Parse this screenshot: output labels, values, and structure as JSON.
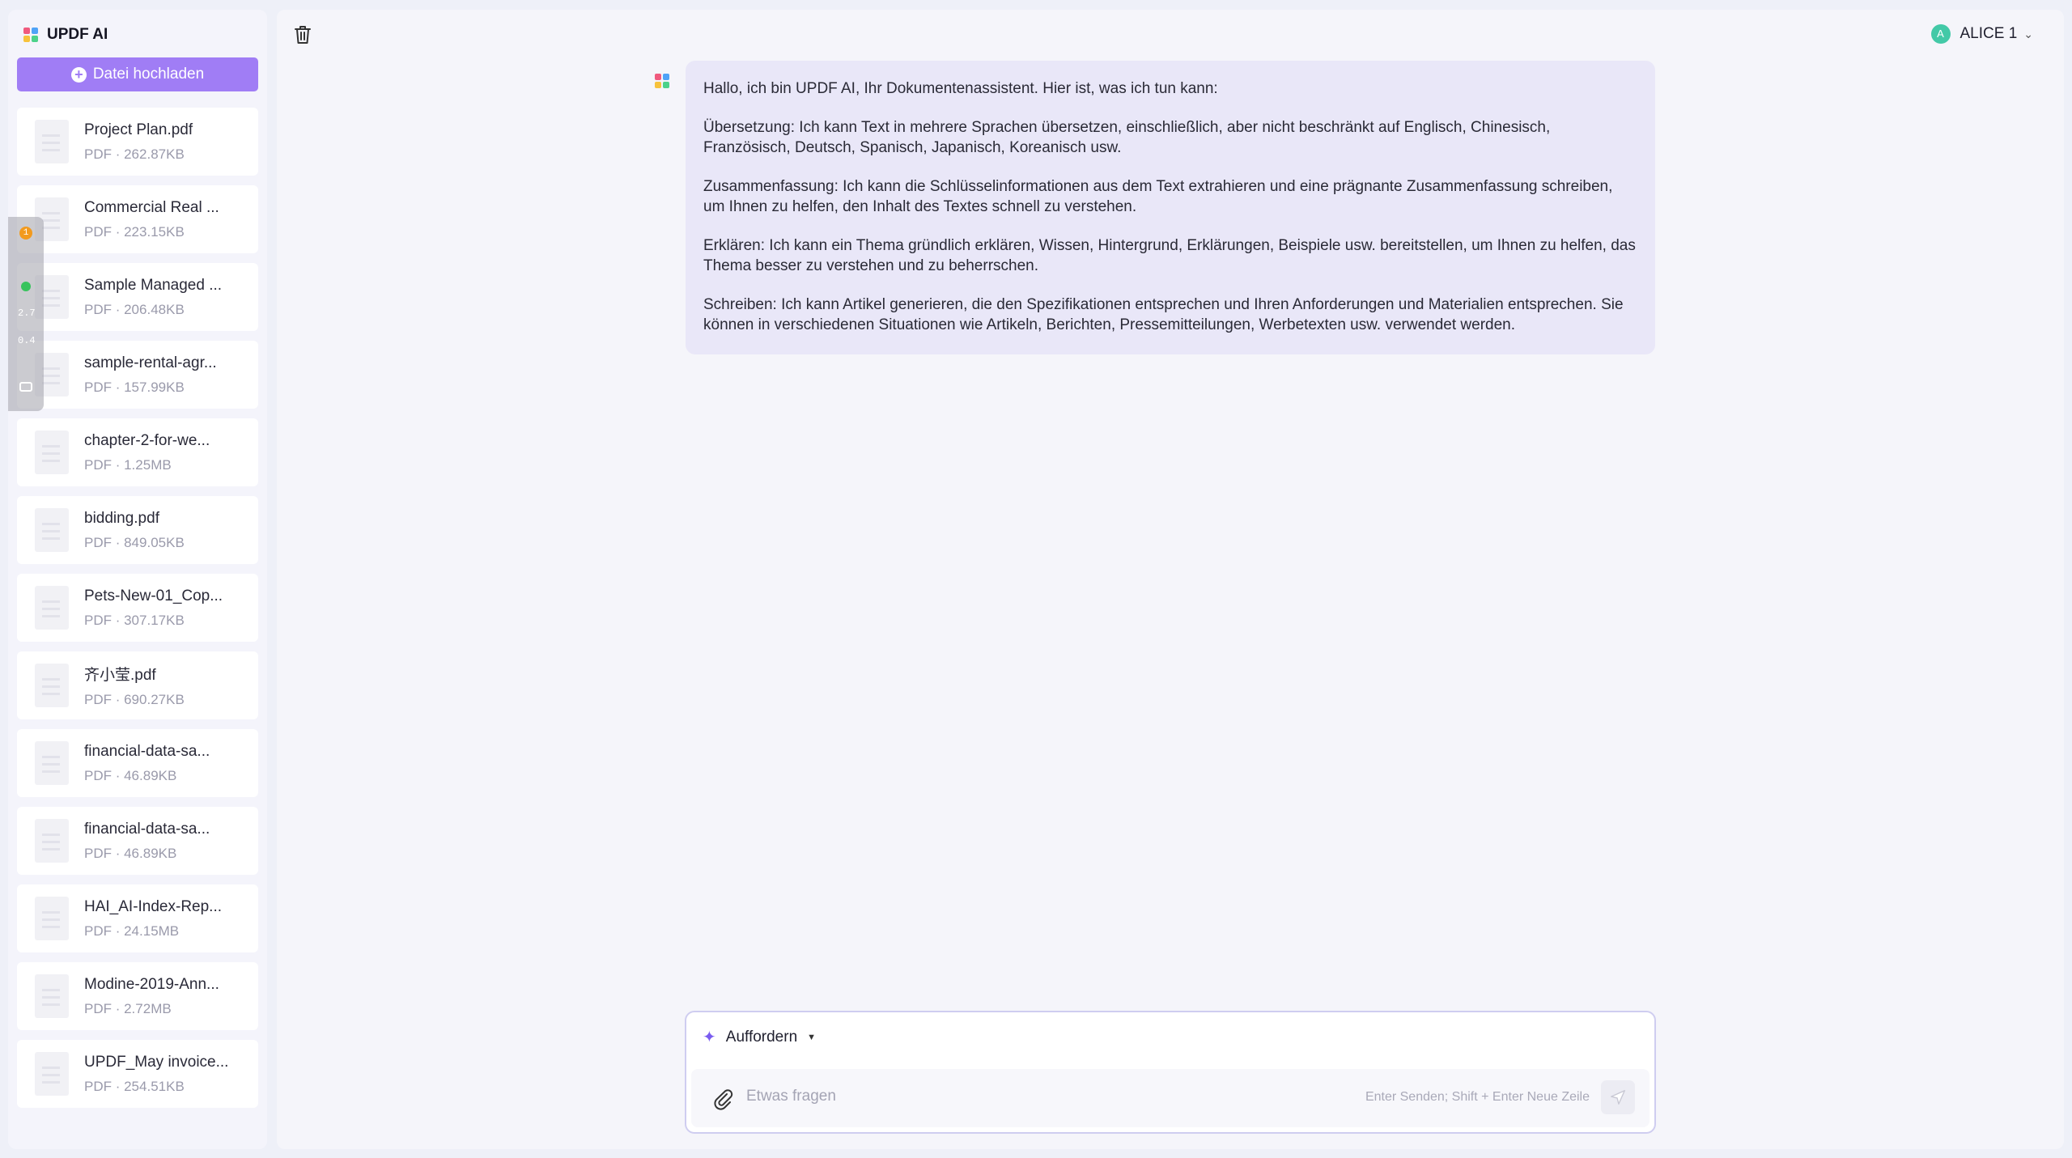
{
  "app": {
    "title": "UPDF AI"
  },
  "sidebar": {
    "upload_label": "Datei hochladen",
    "files": [
      {
        "name": "Project Plan.pdf",
        "meta": "PDF · 262.87KB"
      },
      {
        "name": "Commercial Real ...",
        "meta": "PDF · 223.15KB"
      },
      {
        "name": "Sample Managed ...",
        "meta": "PDF · 206.48KB"
      },
      {
        "name": "sample-rental-agr...",
        "meta": "PDF · 157.99KB"
      },
      {
        "name": "chapter-2-for-we...",
        "meta": "PDF · 1.25MB"
      },
      {
        "name": "bidding.pdf",
        "meta": "PDF · 849.05KB"
      },
      {
        "name": "Pets-New-01_Cop...",
        "meta": "PDF · 307.17KB"
      },
      {
        "name": "齐小莹.pdf",
        "meta": "PDF · 690.27KB"
      },
      {
        "name": "financial-data-sa...",
        "meta": "PDF · 46.89KB"
      },
      {
        "name": "financial-data-sa...",
        "meta": "PDF · 46.89KB"
      },
      {
        "name": "HAI_AI-Index-Rep...",
        "meta": "PDF · 24.15MB"
      },
      {
        "name": "Modine-2019-Ann...",
        "meta": "PDF · 2.72MB"
      },
      {
        "name": "UPDF_May invoice...",
        "meta": "PDF · 254.51KB"
      }
    ]
  },
  "overlay": {
    "badge": "1",
    "upload_speed": "2.7",
    "download_speed": "0.4"
  },
  "header": {
    "user_name": "ALICE 1",
    "avatar_letter": "A"
  },
  "chat": {
    "messages": [
      "Hallo, ich bin UPDF AI, Ihr Dokumentenassistent. Hier ist, was ich tun kann:",
      "Übersetzung: Ich kann Text in mehrere Sprachen übersetzen, einschließlich, aber nicht beschränkt auf Englisch, Chinesisch, Französisch, Deutsch, Spanisch, Japanisch, Koreanisch usw.",
      "Zusammenfassung: Ich kann die Schlüsselinformationen aus dem Text extrahieren und eine prägnante Zusammenfassung schreiben, um Ihnen zu helfen, den Inhalt des Textes schnell zu verstehen.",
      "Erklären: Ich kann ein Thema gründlich erklären, Wissen, Hintergrund, Erklärungen, Beispiele usw. bereitstellen, um Ihnen zu helfen, das Thema besser zu verstehen und zu beherrschen.",
      "Schreiben: Ich kann Artikel generieren, die den Spezifikationen entsprechen und Ihren Anforderungen und Materialien entsprechen. Sie können in verschiedenen Situationen wie Artikeln, Berichten, Pressemitteilungen, Werbetexten usw. verwendet werden."
    ]
  },
  "input": {
    "prompt_label": "Auffordern",
    "placeholder": "Etwas fragen",
    "hint": "Enter Senden; Shift + Enter Neue Zeile"
  },
  "colors": {
    "accent": "#a07df5",
    "bubble": "#e9e7f8",
    "avatar": "#43c9a7"
  },
  "icons": [
    "updf-logo-icon",
    "plus-icon",
    "document-icon",
    "trash-icon",
    "chevron-down-icon",
    "sparkle-icon",
    "paperclip-icon",
    "send-icon"
  ]
}
